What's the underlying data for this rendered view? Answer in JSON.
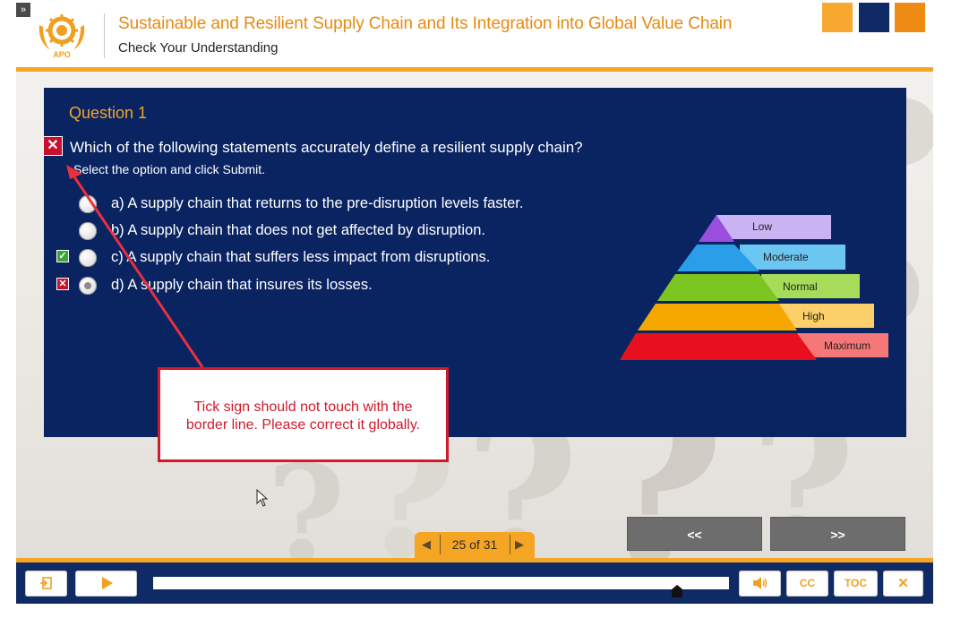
{
  "header": {
    "expand_label": "»",
    "logo_text": "APO",
    "course_title": "Sustainable and Resilient Supply Chain and Its Integration into Global Value Chain",
    "section_title": "Check Your Understanding"
  },
  "question": {
    "number_label": "Question 1",
    "text": "Which of the following statements accurately define a resilient supply chain?",
    "instruction": "Select the option and click Submit.",
    "options": [
      {
        "label": "a)  A supply chain that returns to the pre-disruption levels faster.",
        "selected": false,
        "mark": "none"
      },
      {
        "label": "b)  A supply chain that does not get affected by disruption.",
        "selected": false,
        "mark": "none"
      },
      {
        "label": "c)  A supply chain that suffers less impact from disruptions.",
        "selected": false,
        "mark": "correct"
      },
      {
        "label": "d)  A supply chain that insures its losses.",
        "selected": true,
        "mark": "wrong"
      }
    ]
  },
  "pyramid": {
    "levels": [
      {
        "label": "Low",
        "color": "#9b4fe0"
      },
      {
        "label": "Moderate",
        "color": "#2a9ee8"
      },
      {
        "label": "Normal",
        "color": "#7cc520"
      },
      {
        "label": "High",
        "color": "#f5a800"
      },
      {
        "label": "Maximum",
        "color": "#e8101e"
      }
    ]
  },
  "callout": {
    "text_line1": "Tick sign should not touch with the",
    "text_line2": "border line. Please correct it globally.",
    "color": "#d11a2a"
  },
  "navigation": {
    "prev_label": "<<",
    "next_label": ">>",
    "page_counter": "25 of 31"
  },
  "player": {
    "buttons": [
      "exit-icon",
      "play-icon",
      "volume-icon",
      "CC",
      "TOC",
      "close-icon"
    ],
    "cc_label": "CC",
    "toc_label": "TOC",
    "progress": 0.91
  },
  "colors": {
    "accent": "#f5a524",
    "panel": "#0a2462",
    "footer": "#0f2a64"
  }
}
